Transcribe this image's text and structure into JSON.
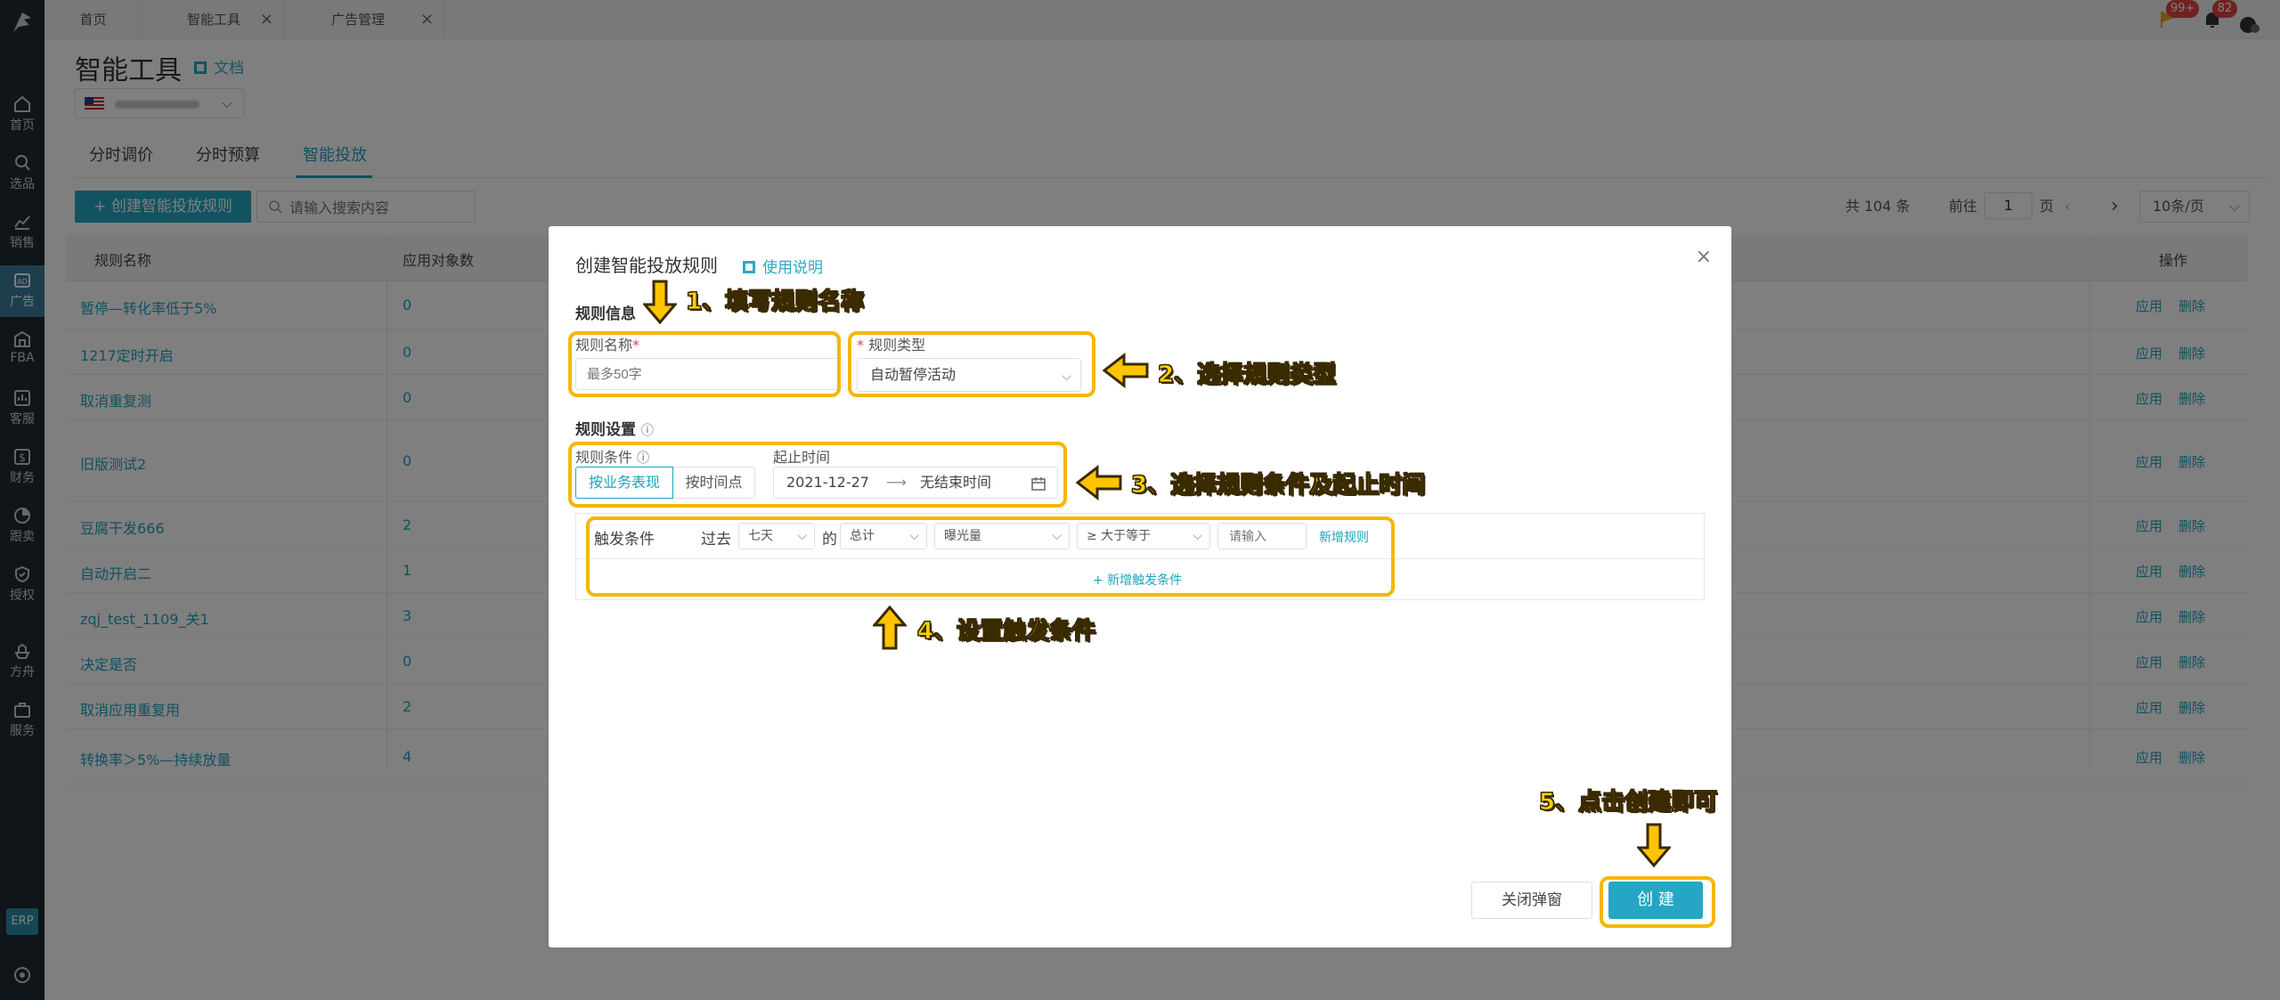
{
  "sidebar": {
    "items": [
      {
        "label": "首页",
        "icon": "home-icon"
      },
      {
        "label": "选品",
        "icon": "search-icon"
      },
      {
        "label": "销售",
        "icon": "chart-icon"
      },
      {
        "label": "广告",
        "icon": "ad-icon"
      },
      {
        "label": "FBA",
        "icon": "warehouse-icon"
      },
      {
        "label": "客服",
        "icon": "message-icon"
      },
      {
        "label": "财务",
        "icon": "dollar-icon"
      },
      {
        "label": "跟卖",
        "icon": "pie-icon"
      },
      {
        "label": "授权",
        "icon": "shield-icon"
      },
      {
        "label": "方舟",
        "icon": "ark-icon"
      },
      {
        "label": "服务",
        "icon": "briefcase-icon"
      }
    ],
    "active": "广告",
    "erp_label": "ERP"
  },
  "tabs": [
    {
      "label": "首页",
      "closable": false
    },
    {
      "label": "智能工具",
      "closable": true
    },
    {
      "label": "广告管理",
      "closable": true
    }
  ],
  "header": {
    "notification_count": "99+",
    "message_count": "82"
  },
  "page": {
    "title": "智能工具",
    "doc_link": "文档",
    "store_flag": "us-flag-icon"
  },
  "subtabs": [
    {
      "label": "分时调价"
    },
    {
      "label": "分时预算"
    },
    {
      "label": "智能投放",
      "active": true
    }
  ],
  "toolbar": {
    "create_label": "+ 创建智能投放规则",
    "search_placeholder": "请输入搜索内容"
  },
  "pager": {
    "total": "共 104 条",
    "goto_label": "前往",
    "page": "1",
    "page_unit": "页",
    "page_size": "10条/页"
  },
  "table": {
    "headers": {
      "name": "规则名称",
      "count": "应用对象数",
      "actions": "操作"
    },
    "action_apply": "应用",
    "action_delete": "删除",
    "rows": [
      {
        "name": "暂停—转化率低于5%",
        "count": "0"
      },
      {
        "name": "1217定时开启",
        "count": "0"
      },
      {
        "name": "取消重复测",
        "count": "0"
      },
      {
        "name": "旧版测试2",
        "count": "0"
      },
      {
        "name": "豆腐干发666",
        "count": "2"
      },
      {
        "name": "自动开启二",
        "count": "1"
      },
      {
        "name": "zqj_test_1109_关1",
        "count": "3"
      },
      {
        "name": "决定是否",
        "count": "0"
      },
      {
        "name": "取消应用重复用",
        "count": "2"
      },
      {
        "name": "转换率＞5%—持续放量",
        "count": "4"
      }
    ]
  },
  "modal": {
    "title": "创建智能投放规则",
    "help_link": "使用说明",
    "section_info": "规则信息",
    "name_label": "规则名称",
    "name_placeholder": "最多50字",
    "type_label": "规则类型",
    "type_value": "自动暂停活动",
    "section_settings": "规则设置",
    "condition_label": "规则条件",
    "condition_options": [
      "按业务表现",
      "按时间点"
    ],
    "condition_selected": "按业务表现",
    "time_label": "起止时间",
    "start_date": "2021-12-27",
    "end_date": "无结束时间",
    "trigger": {
      "label": "触发条件",
      "past_label": "过去",
      "period": "七天",
      "of_label": "的",
      "aggregate": "总计",
      "metric": "曝光量",
      "operator": "≥ 大于等于",
      "value_placeholder": "请输入",
      "add_rule": "新增规则",
      "add_condition": "+ 新增触发条件"
    },
    "btn_close": "关闭弹窗",
    "btn_create": "创 建"
  },
  "annotations": [
    "1、填写规则名称",
    "2、选择规则类型",
    "3、选择规则条件及起止时间",
    "4、设置触发条件",
    "5、点击创建即可"
  ],
  "colors": {
    "primary": "#25a6c5",
    "sidebar_bg": "#1e2a30",
    "highlight": "#f5b700",
    "annotation_text": "#ffd200"
  }
}
